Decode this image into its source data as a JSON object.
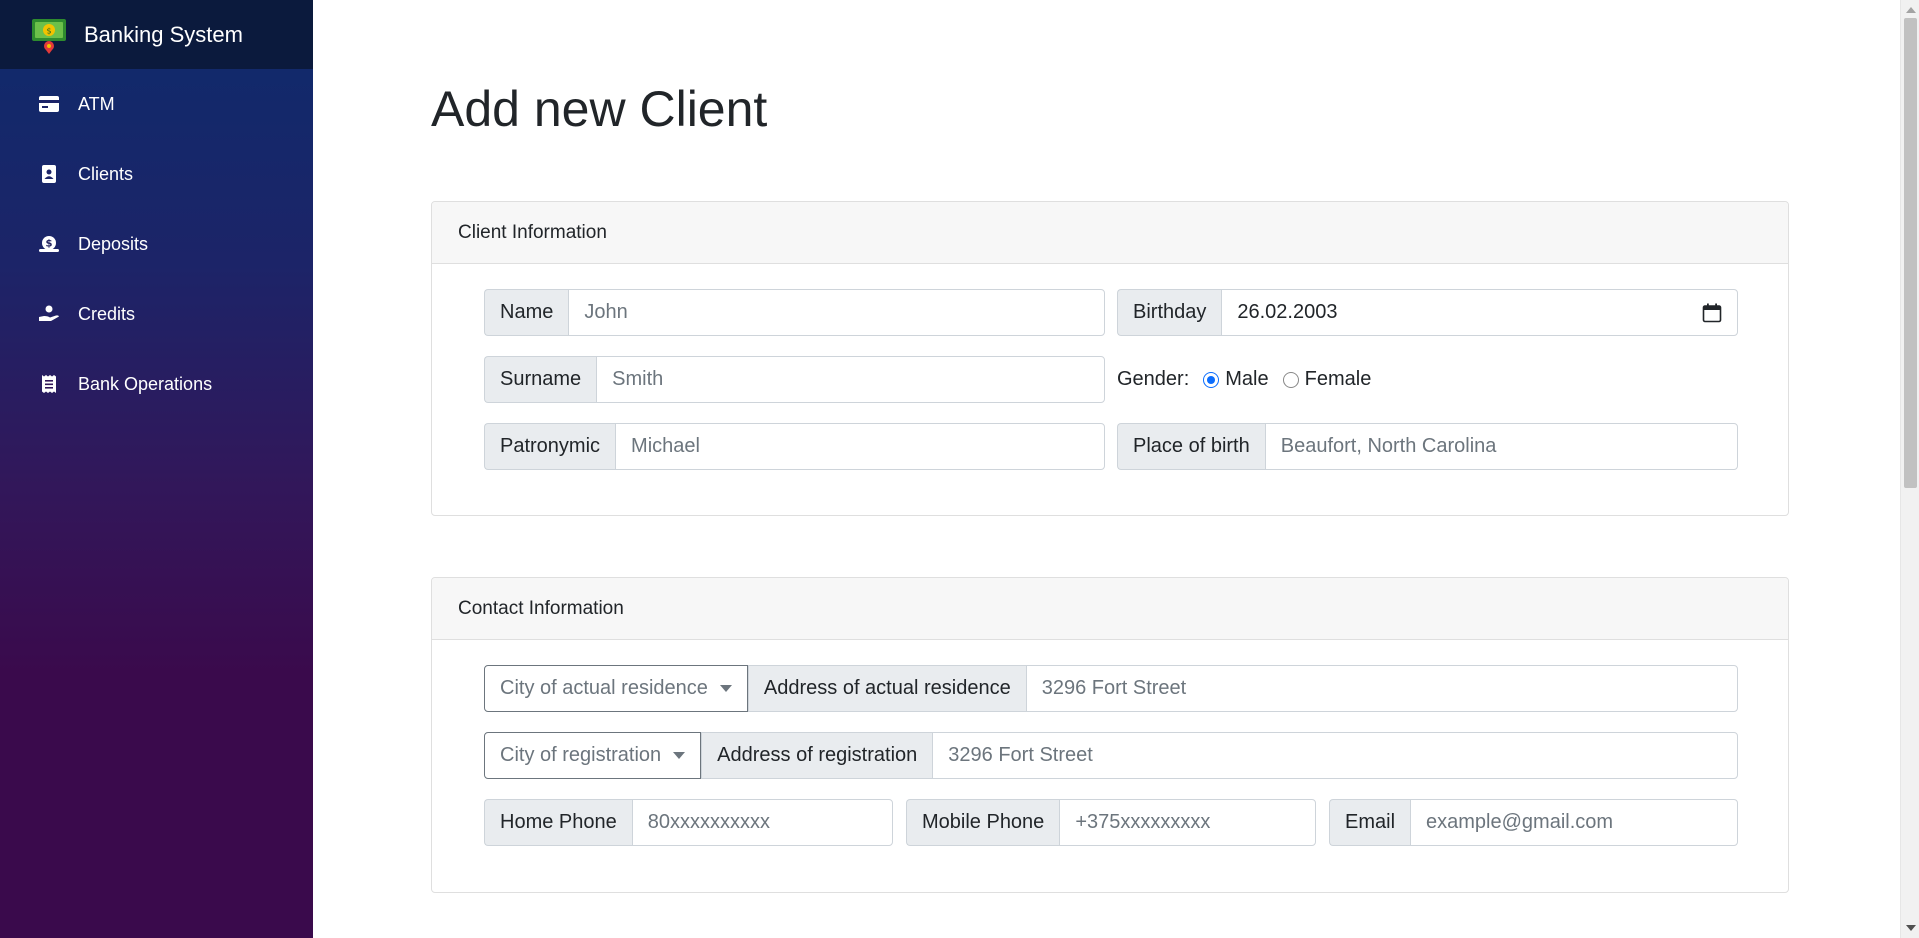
{
  "sidebar": {
    "brand": "Banking System",
    "items": [
      {
        "label": "ATM",
        "icon": "credit-card-icon"
      },
      {
        "label": "Clients",
        "icon": "contact-card-icon"
      },
      {
        "label": "Deposits",
        "icon": "money-bag-icon"
      },
      {
        "label": "Credits",
        "icon": "hand-coin-icon"
      },
      {
        "label": "Bank Operations",
        "icon": "receipt-icon"
      }
    ]
  },
  "page": {
    "title": "Add new Client"
  },
  "client_info": {
    "header": "Client Information",
    "name_label": "Name",
    "name_placeholder": "John",
    "birthday_label": "Birthday",
    "birthday_value": "26.02.2003",
    "surname_label": "Surname",
    "surname_placeholder": "Smith",
    "gender_label": "Gender:",
    "gender_male": "Male",
    "gender_female": "Female",
    "gender_selected": "Male",
    "patronymic_label": "Patronymic",
    "patronymic_placeholder": "Michael",
    "place_label": "Place of birth",
    "place_placeholder": "Beaufort, North Carolina"
  },
  "contact_info": {
    "header": "Contact Information",
    "city_actual": "City of actual residence",
    "address_actual_label": "Address of actual residence",
    "address_actual_placeholder": "3296 Fort Street",
    "city_registration": "City of registration",
    "address_registration_label": "Address of registration",
    "address_registration_placeholder": "3296 Fort Street",
    "home_phone_label": "Home Phone",
    "home_phone_placeholder": "80xxxxxxxxxx",
    "mobile_phone_label": "Mobile Phone",
    "mobile_phone_placeholder": "+375xxxxxxxxx",
    "email_label": "Email",
    "email_placeholder": "example@gmail.com"
  },
  "colors": {
    "accent": "#0d6efd",
    "sidebar_top": "#0e2b6c",
    "sidebar_bottom": "#3a0a4c"
  }
}
